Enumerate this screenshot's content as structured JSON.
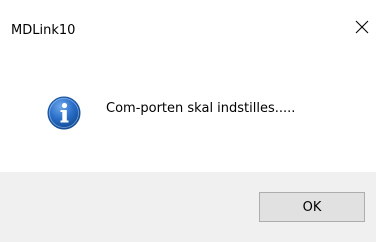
{
  "window": {
    "title": "MDLink10",
    "close_icon": "close-icon"
  },
  "dialog": {
    "icon": "information-icon",
    "message": "Com-porten skal indstilles.....",
    "ok_label": "OK"
  },
  "colors": {
    "footer_bg": "#f0f0f0",
    "button_bg": "#e1e1e1",
    "button_border": "#adadad",
    "icon_blue": "#1f63b8"
  }
}
